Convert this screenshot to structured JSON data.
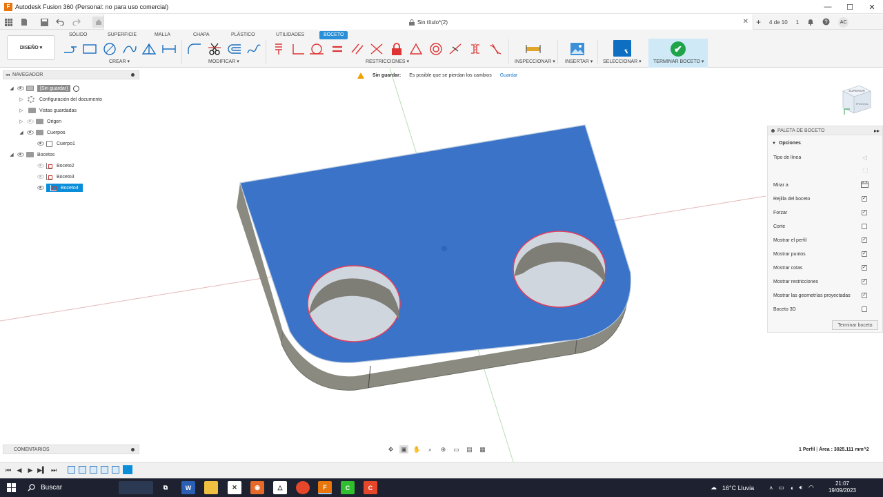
{
  "window": {
    "title": "Autodesk Fusion 360 (Personal: no para uso comercial)",
    "logo_letter": "F",
    "minimize": "—",
    "maximize": "☐",
    "close": "✕"
  },
  "doc_tab": {
    "name": "Sin título*(2)",
    "close": "✕"
  },
  "qat_right": {
    "plus": "+",
    "version_count": "4 de 10",
    "jobs": "1",
    "avatar": "AC"
  },
  "ribbon": {
    "workspace": "DISEÑO ▾",
    "tabs": [
      "SÓLIDO",
      "SUPERFICIE",
      "MALLA",
      "CHAPA",
      "PLÁSTICO",
      "UTILIDADES",
      "BOCETO"
    ],
    "active_tab": "BOCETO",
    "groups": {
      "create": "CREAR ▾",
      "modify": "MODIFICAR ▾",
      "constraints": "RESTRICCIONES ▾",
      "inspect": "INSPECCIONAR ▾",
      "insert": "INSERTAR ▾",
      "select": "SELECCIONAR ▾",
      "finish": "TERMINAR BOCETO ▾"
    },
    "finish_check": "✔"
  },
  "warning": {
    "label": "Sin guardar:",
    "message": "Es posible que se pierdan los cambios",
    "action": "Guardar"
  },
  "navigator": {
    "title": "NAVEGADOR",
    "root": "[Sin guardar]",
    "items": {
      "doc_settings": "Configuración del documento",
      "saved_views": "Vistas guardadas",
      "origin": "Origen",
      "bodies": "Cuerpos",
      "body1": "Cuerpo1",
      "sketches": "Bocetos",
      "sketch2": "Boceto2",
      "sketch3": "Boceto3",
      "sketch4": "Boceto4"
    }
  },
  "palette": {
    "title": "PALETA DE BOCETO",
    "section": "Opciones",
    "options": [
      {
        "label": "Tipo de línea",
        "checked": null
      },
      {
        "label": "Mirar a",
        "checked": null
      },
      {
        "label": "Rejilla del boceto",
        "checked": true
      },
      {
        "label": "Forzar",
        "checked": true
      },
      {
        "label": "Corte",
        "checked": false
      },
      {
        "label": "Mostrar el perfil",
        "checked": true
      },
      {
        "label": "Mostrar puntos",
        "checked": true
      },
      {
        "label": "Mostrar cotas",
        "checked": true
      },
      {
        "label": "Mostrar restricciones",
        "checked": true
      },
      {
        "label": "Mostrar las geometrías proyectadas",
        "checked": true
      },
      {
        "label": "Boceto 3D",
        "checked": false
      }
    ],
    "finish_button": "Terminar boceto"
  },
  "viewcube": {
    "top": "SUPERIOR",
    "front": "FRONTAL"
  },
  "comments": {
    "title": "COMENTARIOS"
  },
  "status": {
    "profile": "1 Perfil",
    "area": "Área : 3025.111 mm^2"
  },
  "taskbar": {
    "search": "Buscar",
    "weather": "16°C Lluvia",
    "time": "21:07",
    "date": "19/09/2023"
  },
  "colors": {
    "accent": "#0a8ed9",
    "face": "#3a73c8",
    "wall": "#8c8c82",
    "warning": "#f0a000",
    "finish_green": "#1fa44a"
  }
}
